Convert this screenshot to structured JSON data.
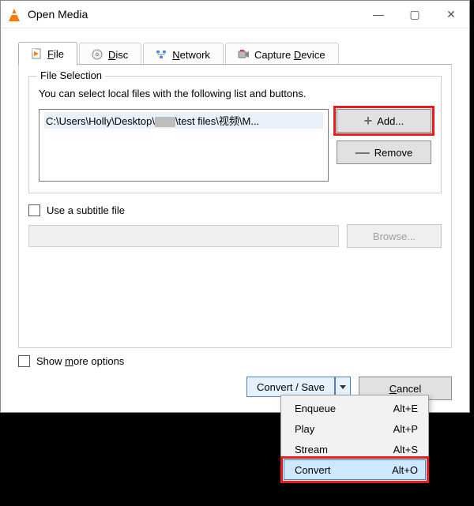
{
  "titlebar": {
    "title": "Open Media"
  },
  "tabs": {
    "file": {
      "label_pre": "",
      "mnemonic": "F",
      "label_post": "ile"
    },
    "disc": {
      "label_pre": "",
      "mnemonic": "D",
      "label_post": "isc"
    },
    "network": {
      "label_pre": "",
      "mnemonic": "N",
      "label_post": "etwork"
    },
    "capture": {
      "label_pre": "Capture ",
      "mnemonic": "D",
      "label_post": "evice"
    }
  },
  "file_selection": {
    "legend": "File Selection",
    "hint": "You can select local files with the following list and buttons.",
    "selected_path_prefix": "C:\\Users\\Holly\\Desktop\\",
    "selected_path_suffix": "\\test files\\视频\\M...",
    "add_label": "Add...",
    "remove_label": "Remove"
  },
  "subtitle": {
    "label": "Use a subtitle file",
    "browse_label": "Browse..."
  },
  "options": {
    "show_more_pre": "Show ",
    "show_more_mnemonic": "m",
    "show_more_post": "ore options"
  },
  "actions": {
    "convert_save": "Convert / Save",
    "cancel_pre": "",
    "cancel_mnemonic": "C",
    "cancel_post": "ancel"
  },
  "menu": {
    "items": [
      {
        "label": "Enqueue",
        "accel": "Alt+E"
      },
      {
        "label": "Play",
        "accel": "Alt+P"
      },
      {
        "label": "Stream",
        "accel": "Alt+S"
      },
      {
        "label": "Convert",
        "accel": "Alt+O"
      }
    ]
  }
}
